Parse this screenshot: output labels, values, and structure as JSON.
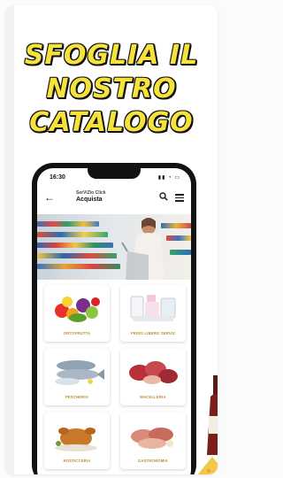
{
  "headline": {
    "lines": [
      "SFOGLIA IL",
      "NOSTRO",
      "CATALOGO"
    ]
  },
  "status_bar": {
    "time": "16:30",
    "icons": "▮▮ ◔ ▭"
  },
  "app_bar": {
    "brand": "SerViZio Click",
    "title": "Acquista"
  },
  "categories": [
    {
      "label": "ORTOFRUTTA",
      "image": "fruit-vegetables"
    },
    {
      "label": "FRIGO LIBERO SERVIZ",
      "image": "dairy-fridge"
    },
    {
      "label": "PESCHERIA",
      "image": "fish"
    },
    {
      "label": "MACELLERIA",
      "image": "meat"
    },
    {
      "label": "ROSTICCERIA",
      "image": "roast-chicken"
    },
    {
      "label": "GASTRONOMIA",
      "image": "deli-cold-cuts"
    }
  ],
  "colors": {
    "headline": "#f6e23b",
    "label": "#c08a2c",
    "phone": "#121212"
  }
}
